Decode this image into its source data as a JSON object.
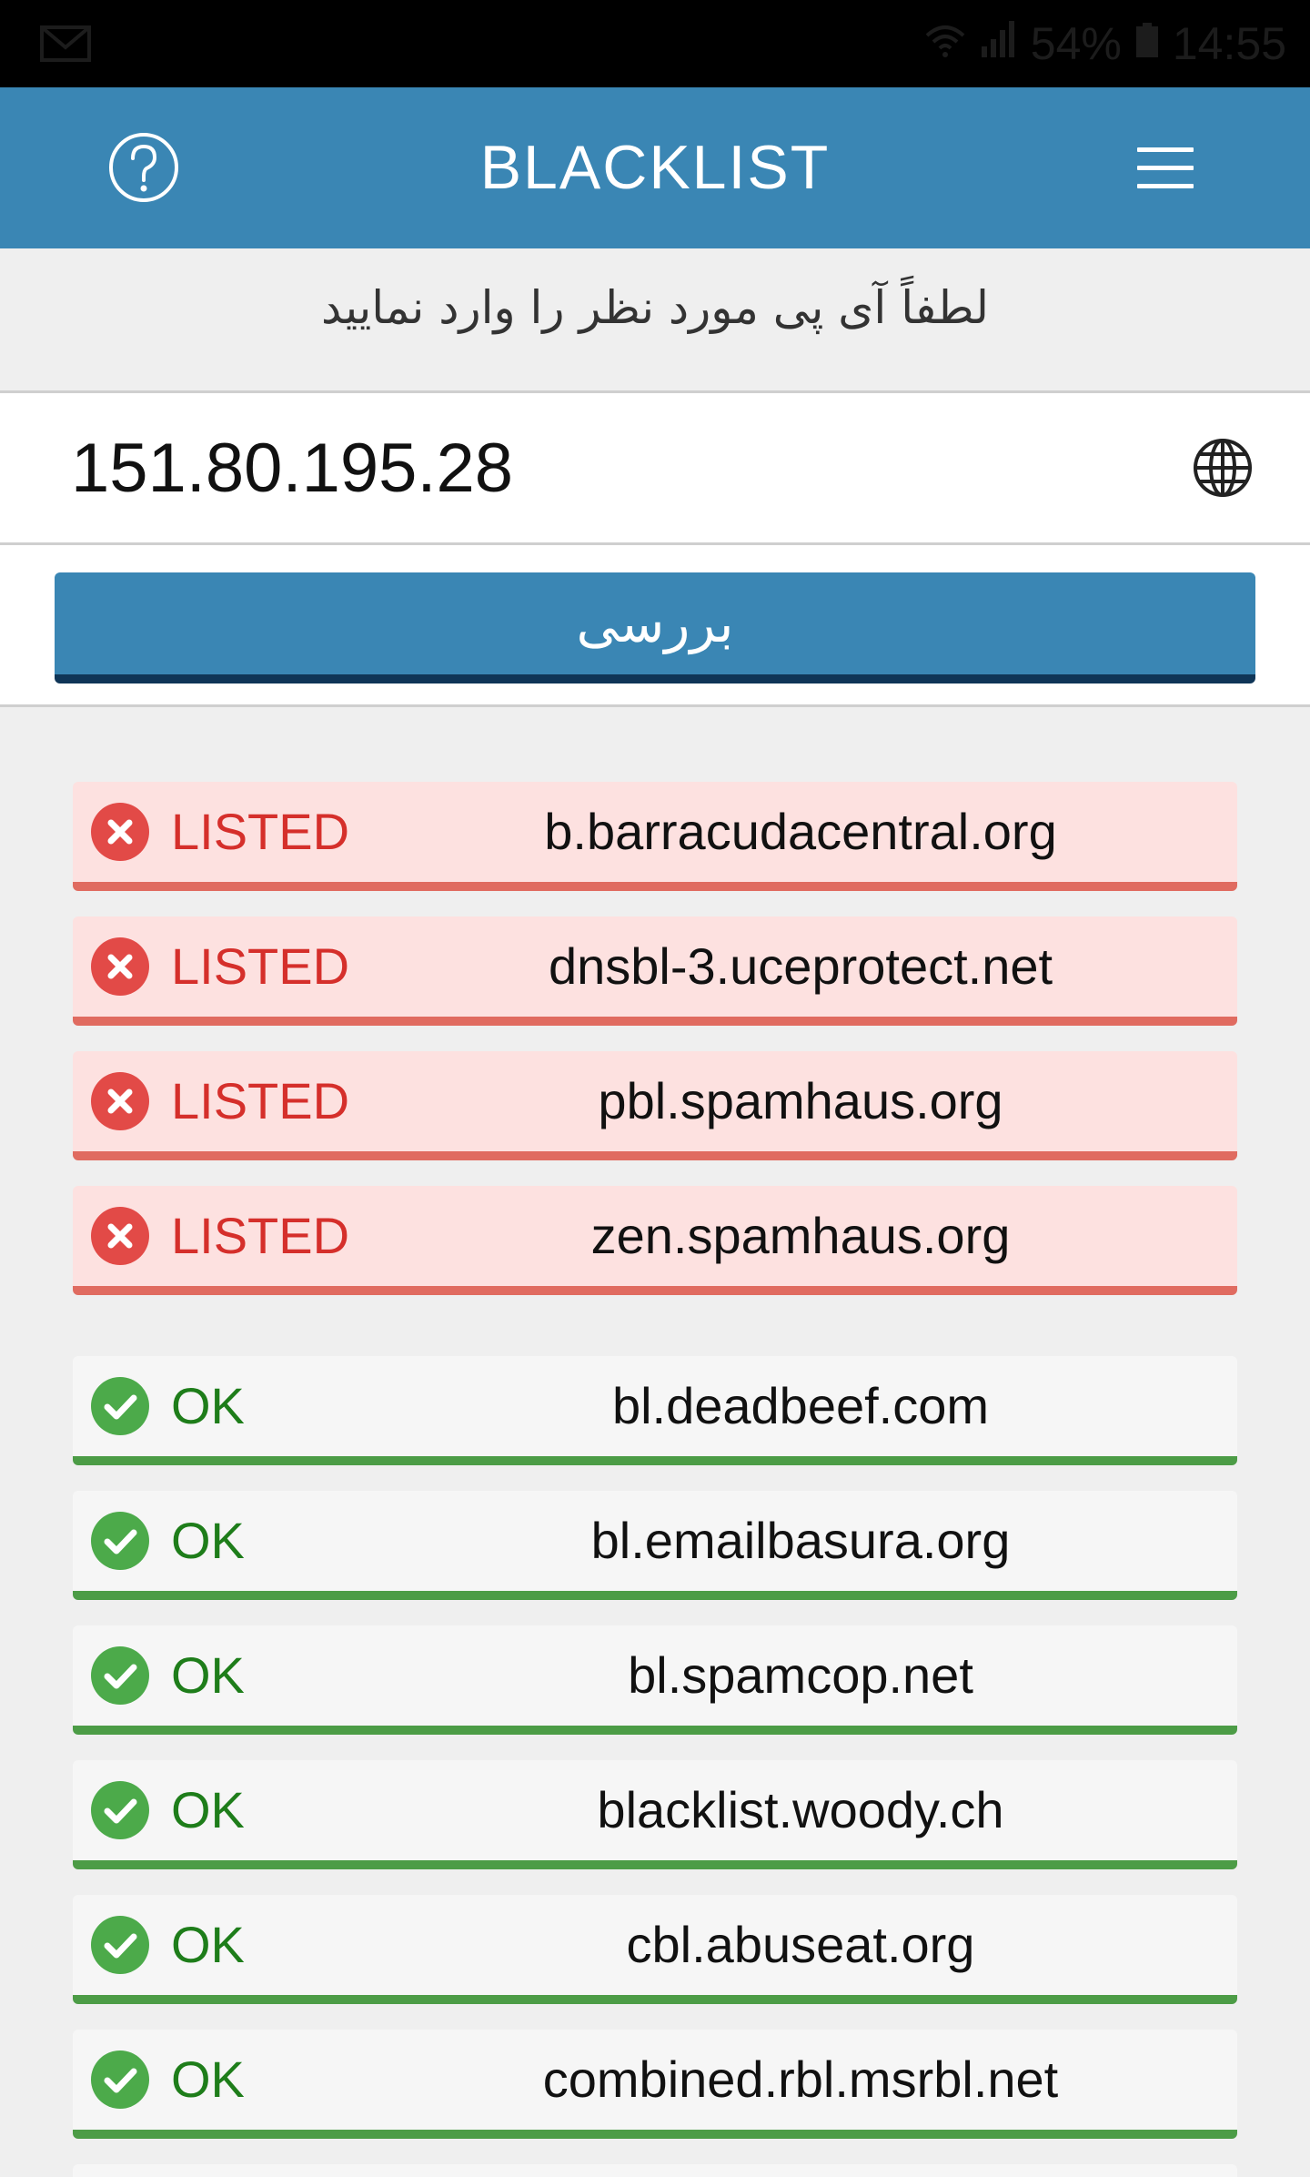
{
  "status_bar": {
    "battery": "54%",
    "time": "14:55"
  },
  "app_bar": {
    "title": "BLACKLIST",
    "help_icon": "help-circle-icon",
    "menu_icon": "hamburger-menu-icon"
  },
  "prompt": {
    "text": "لطفاً آی پی مورد نظر را وارد نمایید"
  },
  "ip_input": {
    "value": "151.80.195.28",
    "icon": "globe-icon"
  },
  "check_button": {
    "label": "بررسی"
  },
  "colors": {
    "app_bar": "#3a86b4",
    "listed_bg": "#fde1e0",
    "listed_border": "#e06b60",
    "listed_text": "#d52f2b",
    "ok_bg": "#f6f6f6",
    "ok_border": "#4c9c46",
    "ok_text": "#1e7d1a"
  },
  "results": [
    {
      "status": "LISTED",
      "server": "b.barracudacentral.org",
      "icon": "error-x-icon"
    },
    {
      "status": "LISTED",
      "server": "dnsbl-3.uceprotect.net",
      "icon": "error-x-icon"
    },
    {
      "status": "LISTED",
      "server": "pbl.spamhaus.org",
      "icon": "error-x-icon"
    },
    {
      "status": "LISTED",
      "server": "zen.spamhaus.org",
      "icon": "error-x-icon"
    },
    {
      "status": "OK",
      "server": "bl.deadbeef.com",
      "icon": "check-icon"
    },
    {
      "status": "OK",
      "server": "bl.emailbasura.org",
      "icon": "check-icon"
    },
    {
      "status": "OK",
      "server": "bl.spamcop.net",
      "icon": "check-icon"
    },
    {
      "status": "OK",
      "server": "blacklist.woody.ch",
      "icon": "check-icon"
    },
    {
      "status": "OK",
      "server": "cbl.abuseat.org",
      "icon": "check-icon"
    },
    {
      "status": "OK",
      "server": "combined.rbl.msrbl.net",
      "icon": "check-icon"
    }
  ]
}
